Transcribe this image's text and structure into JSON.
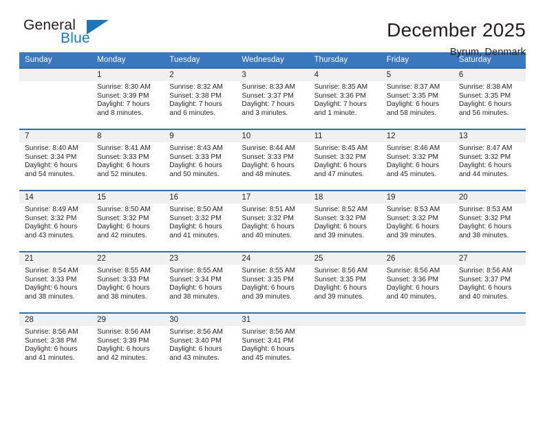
{
  "brand": {
    "name_part1": "General",
    "name_part2": "Blue",
    "accent_color": "#1b75bb"
  },
  "header": {
    "title": "December 2025",
    "subtitle": "Byrum, Denmark"
  },
  "theme": {
    "header_row_bg": "#3b77bc",
    "cell_border": "#2d6cb3",
    "daynum_bg": "#f0f0f0",
    "text_color": "#231f20"
  },
  "weekday_headers": [
    "Sunday",
    "Monday",
    "Tuesday",
    "Wednesday",
    "Thursday",
    "Friday",
    "Saturday"
  ],
  "weeks": [
    [
      {
        "day": "",
        "sunrise": "",
        "sunset": "",
        "daylight_line1": "",
        "daylight_line2": ""
      },
      {
        "day": "1",
        "sunrise": "Sunrise: 8:30 AM",
        "sunset": "Sunset: 3:39 PM",
        "daylight_line1": "Daylight: 7 hours",
        "daylight_line2": "and 8 minutes."
      },
      {
        "day": "2",
        "sunrise": "Sunrise: 8:32 AM",
        "sunset": "Sunset: 3:38 PM",
        "daylight_line1": "Daylight: 7 hours",
        "daylight_line2": "and 6 minutes."
      },
      {
        "day": "3",
        "sunrise": "Sunrise: 8:33 AM",
        "sunset": "Sunset: 3:37 PM",
        "daylight_line1": "Daylight: 7 hours",
        "daylight_line2": "and 3 minutes."
      },
      {
        "day": "4",
        "sunrise": "Sunrise: 8:35 AM",
        "sunset": "Sunset: 3:36 PM",
        "daylight_line1": "Daylight: 7 hours",
        "daylight_line2": "and 1 minute."
      },
      {
        "day": "5",
        "sunrise": "Sunrise: 8:37 AM",
        "sunset": "Sunset: 3:35 PM",
        "daylight_line1": "Daylight: 6 hours",
        "daylight_line2": "and 58 minutes."
      },
      {
        "day": "6",
        "sunrise": "Sunrise: 8:38 AM",
        "sunset": "Sunset: 3:35 PM",
        "daylight_line1": "Daylight: 6 hours",
        "daylight_line2": "and 56 minutes."
      }
    ],
    [
      {
        "day": "7",
        "sunrise": "Sunrise: 8:40 AM",
        "sunset": "Sunset: 3:34 PM",
        "daylight_line1": "Daylight: 6 hours",
        "daylight_line2": "and 54 minutes."
      },
      {
        "day": "8",
        "sunrise": "Sunrise: 8:41 AM",
        "sunset": "Sunset: 3:33 PM",
        "daylight_line1": "Daylight: 6 hours",
        "daylight_line2": "and 52 minutes."
      },
      {
        "day": "9",
        "sunrise": "Sunrise: 8:43 AM",
        "sunset": "Sunset: 3:33 PM",
        "daylight_line1": "Daylight: 6 hours",
        "daylight_line2": "and 50 minutes."
      },
      {
        "day": "10",
        "sunrise": "Sunrise: 8:44 AM",
        "sunset": "Sunset: 3:33 PM",
        "daylight_line1": "Daylight: 6 hours",
        "daylight_line2": "and 48 minutes."
      },
      {
        "day": "11",
        "sunrise": "Sunrise: 8:45 AM",
        "sunset": "Sunset: 3:32 PM",
        "daylight_line1": "Daylight: 6 hours",
        "daylight_line2": "and 47 minutes."
      },
      {
        "day": "12",
        "sunrise": "Sunrise: 8:46 AM",
        "sunset": "Sunset: 3:32 PM",
        "daylight_line1": "Daylight: 6 hours",
        "daylight_line2": "and 45 minutes."
      },
      {
        "day": "13",
        "sunrise": "Sunrise: 8:47 AM",
        "sunset": "Sunset: 3:32 PM",
        "daylight_line1": "Daylight: 6 hours",
        "daylight_line2": "and 44 minutes."
      }
    ],
    [
      {
        "day": "14",
        "sunrise": "Sunrise: 8:49 AM",
        "sunset": "Sunset: 3:32 PM",
        "daylight_line1": "Daylight: 6 hours",
        "daylight_line2": "and 43 minutes."
      },
      {
        "day": "15",
        "sunrise": "Sunrise: 8:50 AM",
        "sunset": "Sunset: 3:32 PM",
        "daylight_line1": "Daylight: 6 hours",
        "daylight_line2": "and 42 minutes."
      },
      {
        "day": "16",
        "sunrise": "Sunrise: 8:50 AM",
        "sunset": "Sunset: 3:32 PM",
        "daylight_line1": "Daylight: 6 hours",
        "daylight_line2": "and 41 minutes."
      },
      {
        "day": "17",
        "sunrise": "Sunrise: 8:51 AM",
        "sunset": "Sunset: 3:32 PM",
        "daylight_line1": "Daylight: 6 hours",
        "daylight_line2": "and 40 minutes."
      },
      {
        "day": "18",
        "sunrise": "Sunrise: 8:52 AM",
        "sunset": "Sunset: 3:32 PM",
        "daylight_line1": "Daylight: 6 hours",
        "daylight_line2": "and 39 minutes."
      },
      {
        "day": "19",
        "sunrise": "Sunrise: 8:53 AM",
        "sunset": "Sunset: 3:32 PM",
        "daylight_line1": "Daylight: 6 hours",
        "daylight_line2": "and 39 minutes."
      },
      {
        "day": "20",
        "sunrise": "Sunrise: 8:53 AM",
        "sunset": "Sunset: 3:32 PM",
        "daylight_line1": "Daylight: 6 hours",
        "daylight_line2": "and 38 minutes."
      }
    ],
    [
      {
        "day": "21",
        "sunrise": "Sunrise: 8:54 AM",
        "sunset": "Sunset: 3:33 PM",
        "daylight_line1": "Daylight: 6 hours",
        "daylight_line2": "and 38 minutes."
      },
      {
        "day": "22",
        "sunrise": "Sunrise: 8:55 AM",
        "sunset": "Sunset: 3:33 PM",
        "daylight_line1": "Daylight: 6 hours",
        "daylight_line2": "and 38 minutes."
      },
      {
        "day": "23",
        "sunrise": "Sunrise: 8:55 AM",
        "sunset": "Sunset: 3:34 PM",
        "daylight_line1": "Daylight: 6 hours",
        "daylight_line2": "and 38 minutes."
      },
      {
        "day": "24",
        "sunrise": "Sunrise: 8:55 AM",
        "sunset": "Sunset: 3:35 PM",
        "daylight_line1": "Daylight: 6 hours",
        "daylight_line2": "and 39 minutes."
      },
      {
        "day": "25",
        "sunrise": "Sunrise: 8:56 AM",
        "sunset": "Sunset: 3:35 PM",
        "daylight_line1": "Daylight: 6 hours",
        "daylight_line2": "and 39 minutes."
      },
      {
        "day": "26",
        "sunrise": "Sunrise: 8:56 AM",
        "sunset": "Sunset: 3:36 PM",
        "daylight_line1": "Daylight: 6 hours",
        "daylight_line2": "and 40 minutes."
      },
      {
        "day": "27",
        "sunrise": "Sunrise: 8:56 AM",
        "sunset": "Sunset: 3:37 PM",
        "daylight_line1": "Daylight: 6 hours",
        "daylight_line2": "and 40 minutes."
      }
    ],
    [
      {
        "day": "28",
        "sunrise": "Sunrise: 8:56 AM",
        "sunset": "Sunset: 3:38 PM",
        "daylight_line1": "Daylight: 6 hours",
        "daylight_line2": "and 41 minutes."
      },
      {
        "day": "29",
        "sunrise": "Sunrise: 8:56 AM",
        "sunset": "Sunset: 3:39 PM",
        "daylight_line1": "Daylight: 6 hours",
        "daylight_line2": "and 42 minutes."
      },
      {
        "day": "30",
        "sunrise": "Sunrise: 8:56 AM",
        "sunset": "Sunset: 3:40 PM",
        "daylight_line1": "Daylight: 6 hours",
        "daylight_line2": "and 43 minutes."
      },
      {
        "day": "31",
        "sunrise": "Sunrise: 8:56 AM",
        "sunset": "Sunset: 3:41 PM",
        "daylight_line1": "Daylight: 6 hours",
        "daylight_line2": "and 45 minutes."
      },
      {
        "day": "",
        "sunrise": "",
        "sunset": "",
        "daylight_line1": "",
        "daylight_line2": ""
      },
      {
        "day": "",
        "sunrise": "",
        "sunset": "",
        "daylight_line1": "",
        "daylight_line2": ""
      },
      {
        "day": "",
        "sunrise": "",
        "sunset": "",
        "daylight_line1": "",
        "daylight_line2": ""
      }
    ]
  ]
}
